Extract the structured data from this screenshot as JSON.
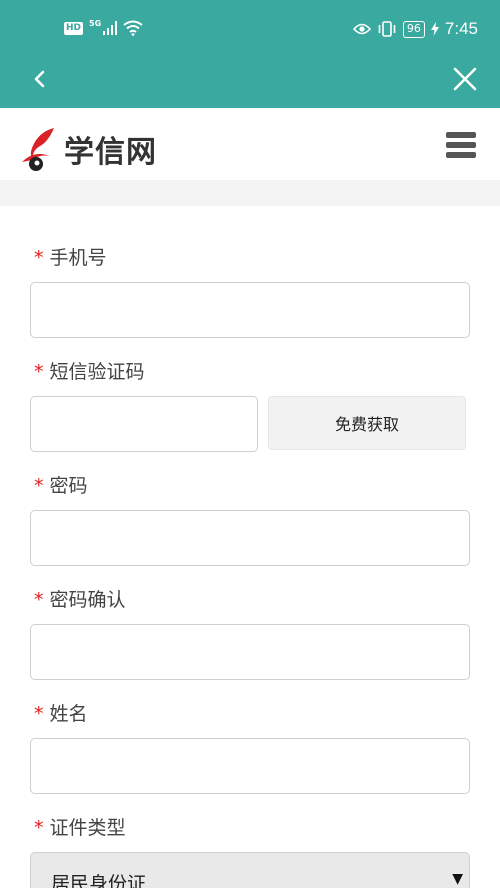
{
  "status_bar": {
    "hd": "HD",
    "network": "5G",
    "battery": "96",
    "time": "7:45"
  },
  "nav": {
    "back_icon": "chevron-left-icon",
    "close_icon": "close-icon"
  },
  "header": {
    "logo_text": "学信网",
    "menu_icon": "hamburger-menu-icon"
  },
  "form": {
    "required_mark": "*",
    "fields": [
      {
        "label": "手机号",
        "value": ""
      },
      {
        "label": "短信验证码",
        "value": "",
        "button": "免费获取"
      },
      {
        "label": "密码",
        "value": ""
      },
      {
        "label": "密码确认",
        "value": ""
      },
      {
        "label": "姓名",
        "value": ""
      },
      {
        "label": "证件类型",
        "selected": "居民身份证"
      }
    ]
  },
  "colors": {
    "topbar": "#3aa99f",
    "required": "#e02020",
    "logo_red": "#d92128"
  }
}
